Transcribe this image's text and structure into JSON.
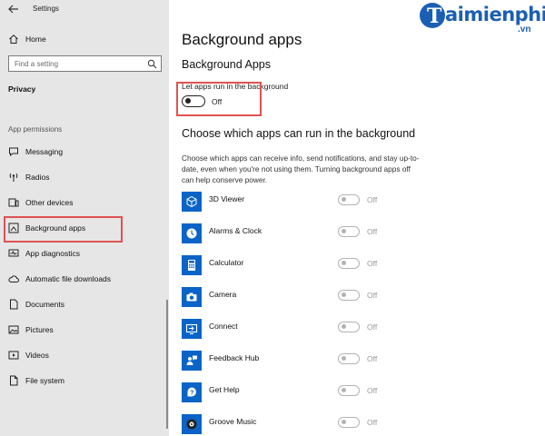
{
  "window": {
    "title": "Settings"
  },
  "sidebar": {
    "home_label": "Home",
    "search_placeholder": "Find a setting",
    "section_title": "Privacy",
    "group_label": "App permissions",
    "items": [
      {
        "label": "Messaging",
        "icon": "message-icon"
      },
      {
        "label": "Radios",
        "icon": "radio-icon"
      },
      {
        "label": "Other devices",
        "icon": "devices-icon"
      },
      {
        "label": "Background apps",
        "icon": "background-apps-icon",
        "selected": true
      },
      {
        "label": "App diagnostics",
        "icon": "diagnostics-icon"
      },
      {
        "label": "Automatic file downloads",
        "icon": "cloud-icon"
      },
      {
        "label": "Documents",
        "icon": "document-icon"
      },
      {
        "label": "Pictures",
        "icon": "picture-icon"
      },
      {
        "label": "Videos",
        "icon": "video-icon"
      },
      {
        "label": "File system",
        "icon": "file-icon"
      }
    ]
  },
  "main": {
    "title": "Background apps",
    "subtitle": "Background Apps",
    "toggle_label": "Let apps run in the background",
    "toggle_state": "Off",
    "choose_title": "Choose which apps can run in the background",
    "choose_description": "Choose which apps can receive info, send notifications, and stay up-to-date, even when you're not using them. Turning background apps off can help conserve power.",
    "apps": [
      {
        "name": "3D Viewer",
        "state": "Off",
        "icon": "cube-icon"
      },
      {
        "name": "Alarms & Clock",
        "state": "Off",
        "icon": "clock-icon"
      },
      {
        "name": "Calculator",
        "state": "Off",
        "icon": "calculator-icon"
      },
      {
        "name": "Camera",
        "state": "Off",
        "icon": "camera-icon"
      },
      {
        "name": "Connect",
        "state": "Off",
        "icon": "connect-icon"
      },
      {
        "name": "Feedback Hub",
        "state": "Off",
        "icon": "feedback-icon"
      },
      {
        "name": "Get Help",
        "state": "Off",
        "icon": "help-icon"
      },
      {
        "name": "Groove Music",
        "state": "Off",
        "icon": "music-icon"
      }
    ]
  },
  "watermark": {
    "brand": "aimienphi",
    "initial": "T",
    "domain": ".vn"
  },
  "colors": {
    "accent": "#0a64c8",
    "highlight": "#e05252",
    "sidebar_bg": "#e6e6e6",
    "logo": "#1a5fb4"
  }
}
